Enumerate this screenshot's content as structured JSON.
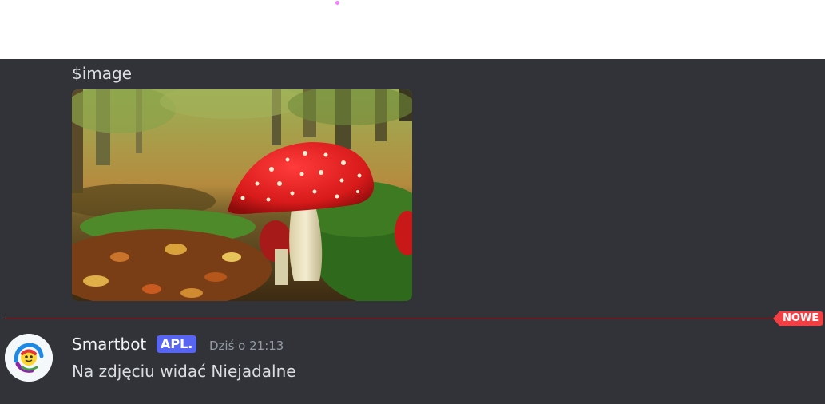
{
  "previous_message": {
    "text": "$image",
    "attachment_icon": "mushroom-photo"
  },
  "divider": {
    "label": "NOWE",
    "color": "#f23f43"
  },
  "message": {
    "author": "Smartbot",
    "badge": "APL.",
    "timestamp": "Dziś o 21:13",
    "content": "Na zdjęciu widać Niejadalne",
    "avatar_icon": "smartbot-logo-icon"
  },
  "colors": {
    "background": "#313338",
    "badge": "#5865f2",
    "text": "#dbdee1"
  }
}
